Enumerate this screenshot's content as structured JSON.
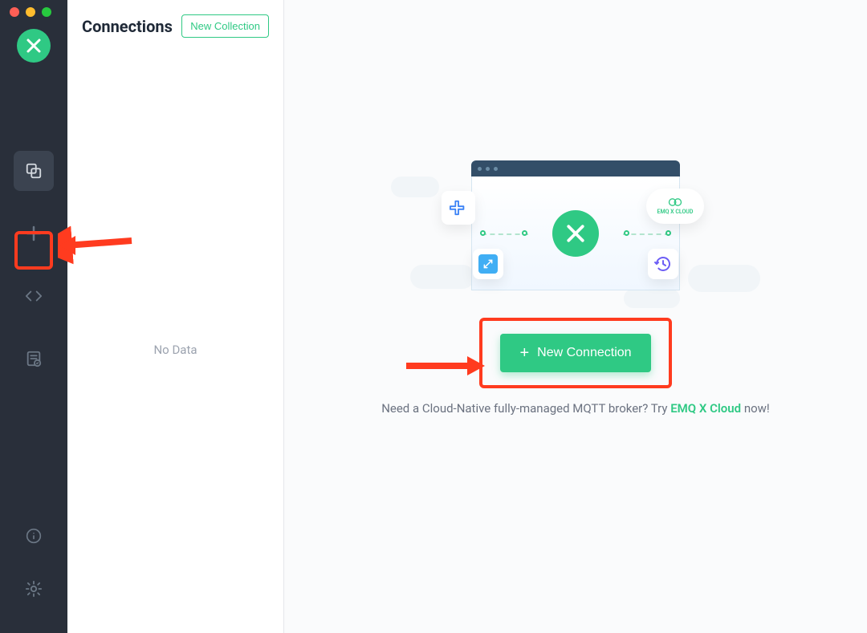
{
  "panel": {
    "title": "Connections",
    "new_collection_label": "New Collection",
    "no_data_text": "No Data"
  },
  "main": {
    "new_connection_label": "New Connection",
    "cloud_prompt_prefix": "Need a Cloud-Native fully-managed MQTT broker? Try ",
    "cloud_link_label": "EMQ X Cloud",
    "cloud_prompt_suffix": " now!",
    "illustration_cloud_label": "EMQ X CLOUD"
  },
  "colors": {
    "accent": "#2fc984",
    "annotation": "#ff3b1f"
  }
}
